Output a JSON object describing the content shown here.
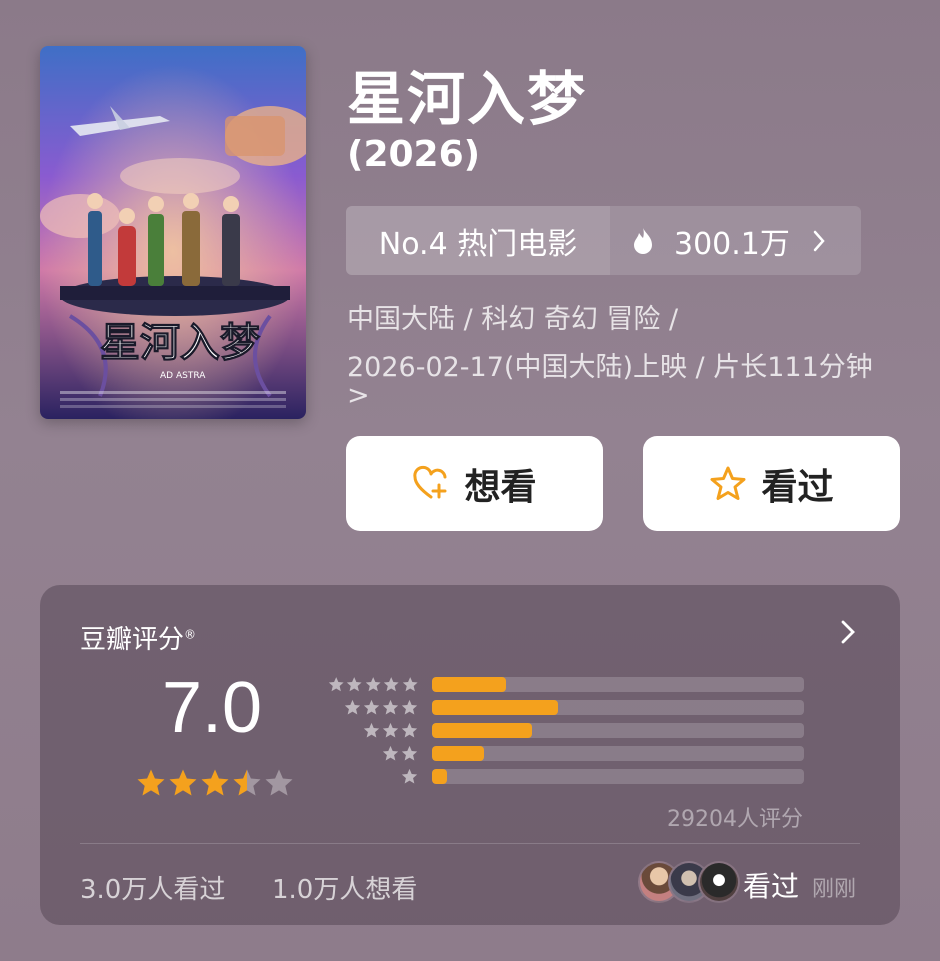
{
  "movie": {
    "title": "星河入梦",
    "year": "(2026)",
    "poster_art_text": "星河入梦"
  },
  "ranking": {
    "label": "No.4 热门电影",
    "heat": "300.1万",
    "heat_icon": "fire-icon"
  },
  "meta": {
    "line1": "中国大陆 / 科幻 奇幻 冒险 /",
    "line2": "2026-02-17(中国大陆)上映 / 片长111分钟",
    "line3": ">"
  },
  "actions": {
    "want_label": "想看",
    "seen_label": "看过"
  },
  "rating": {
    "title": "豆瓣评分",
    "registered_mark": "®",
    "score": "7.0",
    "stars_value": 3.5,
    "distribution": [
      {
        "stars": 5,
        "fraction": 0.2
      },
      {
        "stars": 4,
        "fraction": 0.34
      },
      {
        "stars": 3,
        "fraction": 0.27
      },
      {
        "stars": 2,
        "fraction": 0.14
      },
      {
        "stars": 1,
        "fraction": 0.04
      }
    ],
    "count_text": "29204人评分"
  },
  "stats": {
    "seen_count": "3.0万人看过",
    "want_count": "1.0万人想看"
  },
  "friends": {
    "status_label": "看过",
    "time_label": "刚刚"
  },
  "colors": {
    "accent": "#f4a11d",
    "background": "#8f7e8d"
  }
}
